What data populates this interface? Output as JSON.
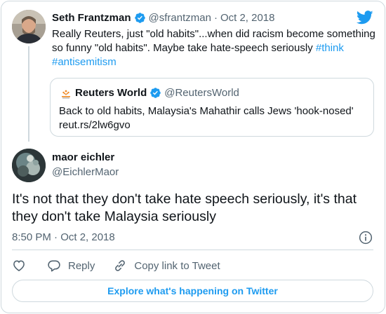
{
  "colors": {
    "accent": "#1d9bf0",
    "text": "#0f1419",
    "muted": "#536471",
    "border": "#cfd9de"
  },
  "parent_tweet": {
    "author_name": "Seth Frantzman",
    "handle": "@sfrantzman",
    "separator": "·",
    "date": "Oct 2, 2018",
    "text_part1": "Really Reuters, just \"old habits\"...when did racism become something so funny \"old habits\". Maybe take hate-speech seriously",
    "hashtag1": "#think",
    "hashtag2": "#antisemitism",
    "avatar_icon": "user-avatar",
    "verified_icon": "verified-badge-icon"
  },
  "quoted_tweet": {
    "author_name": "Reuters World",
    "handle": "@ReutersWorld",
    "text_line1": "Back to old habits, Malaysia's Mahathir calls Jews 'hook-nosed'",
    "text_line2": "reut.rs/2lw6gvo",
    "avatar_icon": "reuters-logo-icon",
    "verified_icon": "verified-badge-icon"
  },
  "main_tweet": {
    "author_name": "maor eichler",
    "handle": "@EichlerMaor",
    "text": "It's not that they don't take hate speech seriously, it's that they don't take Malaysia seriously",
    "timestamp": "8:50 PM · Oct 2, 2018",
    "avatar_icon": "user-avatar"
  },
  "actions": {
    "like_icon": "heart-icon",
    "reply_label": "Reply",
    "reply_icon": "speech-bubble-icon",
    "copy_label": "Copy link to Tweet",
    "copy_icon": "link-icon",
    "info_icon": "info-icon"
  },
  "explore_label": "Explore what's happening on Twitter",
  "brand_icon": "twitter-bird-icon"
}
